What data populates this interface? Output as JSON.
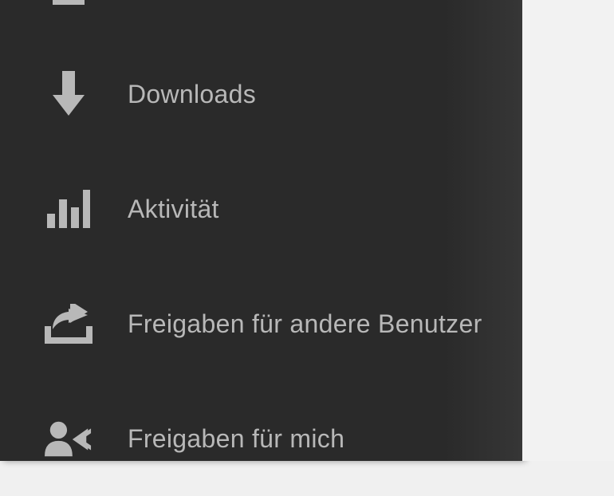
{
  "sidebar": {
    "items": [
      {
        "label": "",
        "icon": "partial-top-icon"
      },
      {
        "label": "Downloads",
        "icon": "download-arrow-icon"
      },
      {
        "label": "Aktivität",
        "icon": "bar-chart-icon"
      },
      {
        "label": "Freigaben für andere Benutzer",
        "icon": "share-out-icon"
      },
      {
        "label": "Freigaben für mich",
        "icon": "shared-with-me-icon"
      }
    ]
  },
  "colors": {
    "icon": "#b8b8b8",
    "text": "#b8b8b8",
    "sidebar_bg": "#2a2a2a"
  }
}
